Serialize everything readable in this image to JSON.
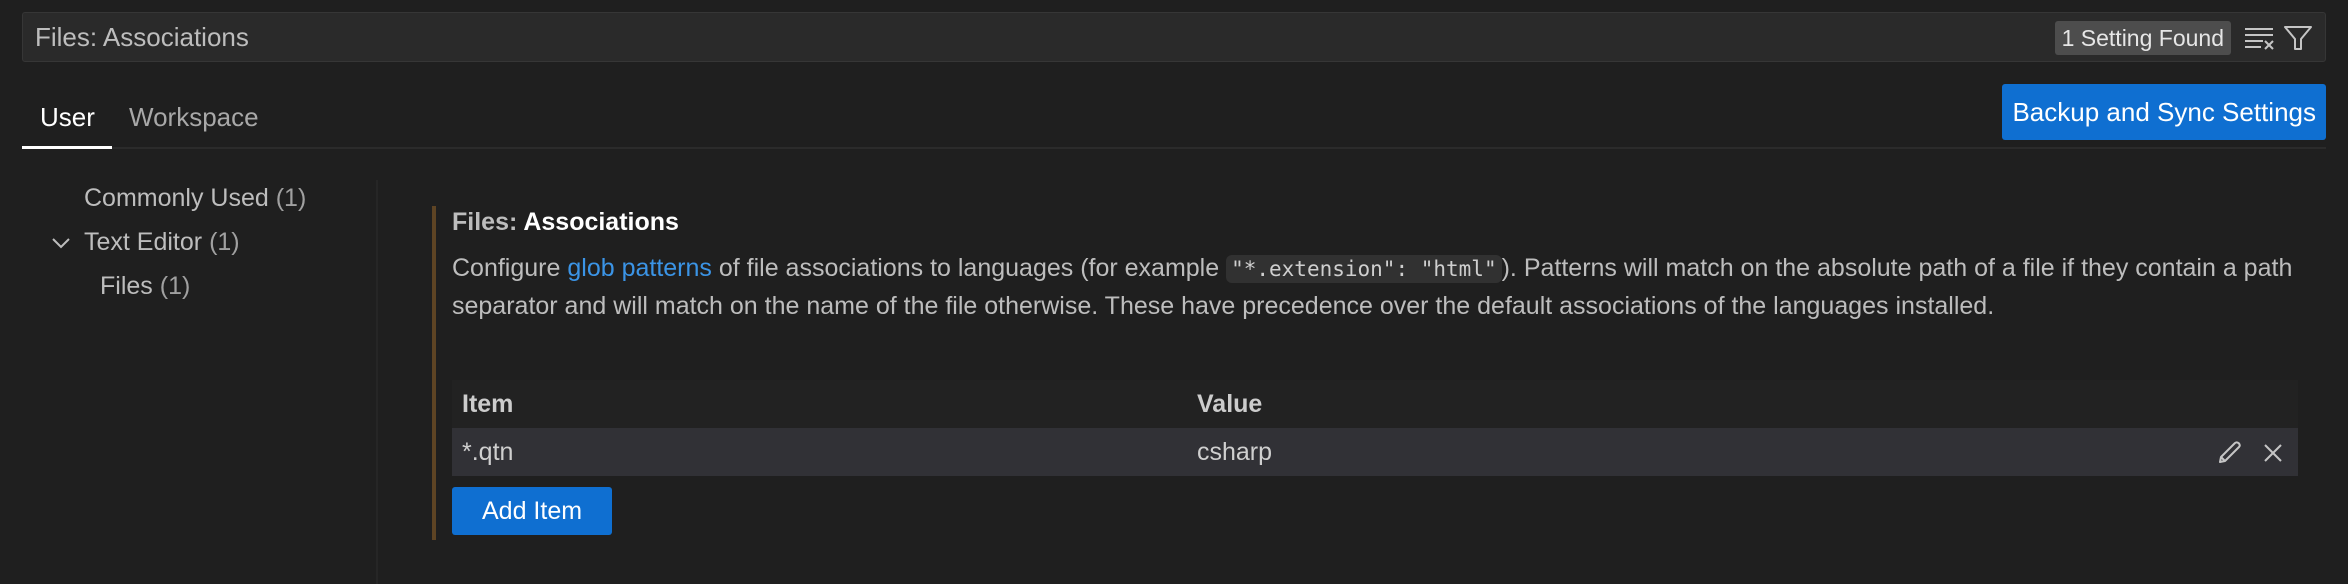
{
  "search": {
    "value": "Files: Associations",
    "result_count": "1 Setting Found",
    "clear_icon": "clear-filter-icon",
    "filter_icon": "filter-icon"
  },
  "tabs": [
    {
      "label": "User",
      "active": true
    },
    {
      "label": "Workspace",
      "active": false
    }
  ],
  "sync_button": {
    "label": "Backup and Sync Settings"
  },
  "toc": {
    "items": [
      {
        "label": "Commonly Used",
        "count": "(1)",
        "level": 0,
        "expanded": null
      },
      {
        "label": "Text Editor",
        "count": "(1)",
        "level": 0,
        "expanded": true
      },
      {
        "label": "Files",
        "count": "(1)",
        "level": 1,
        "expanded": null
      }
    ]
  },
  "setting": {
    "category": "Files: ",
    "name": "Associations",
    "description": {
      "prefix": "Configure ",
      "link_text": "glob patterns",
      "middle": " of file associations to languages (for example ",
      "code": "\"*.extension\": \"html\"",
      "suffix": "). Patterns will match on the absolute path of a file if they contain a path separator and will match on the name of the file otherwise. These have precedence over the default associations of the languages installed."
    },
    "table": {
      "headers": {
        "item": "Item",
        "value": "Value"
      },
      "rows": [
        {
          "item": "*.qtn",
          "value": "csharp"
        }
      ]
    },
    "add_button": "Add Item"
  },
  "colors": {
    "accent": "#0f6fd1",
    "link": "#3b94e6",
    "modified_indicator": "#5e4424",
    "background": "#1f1f1f"
  }
}
